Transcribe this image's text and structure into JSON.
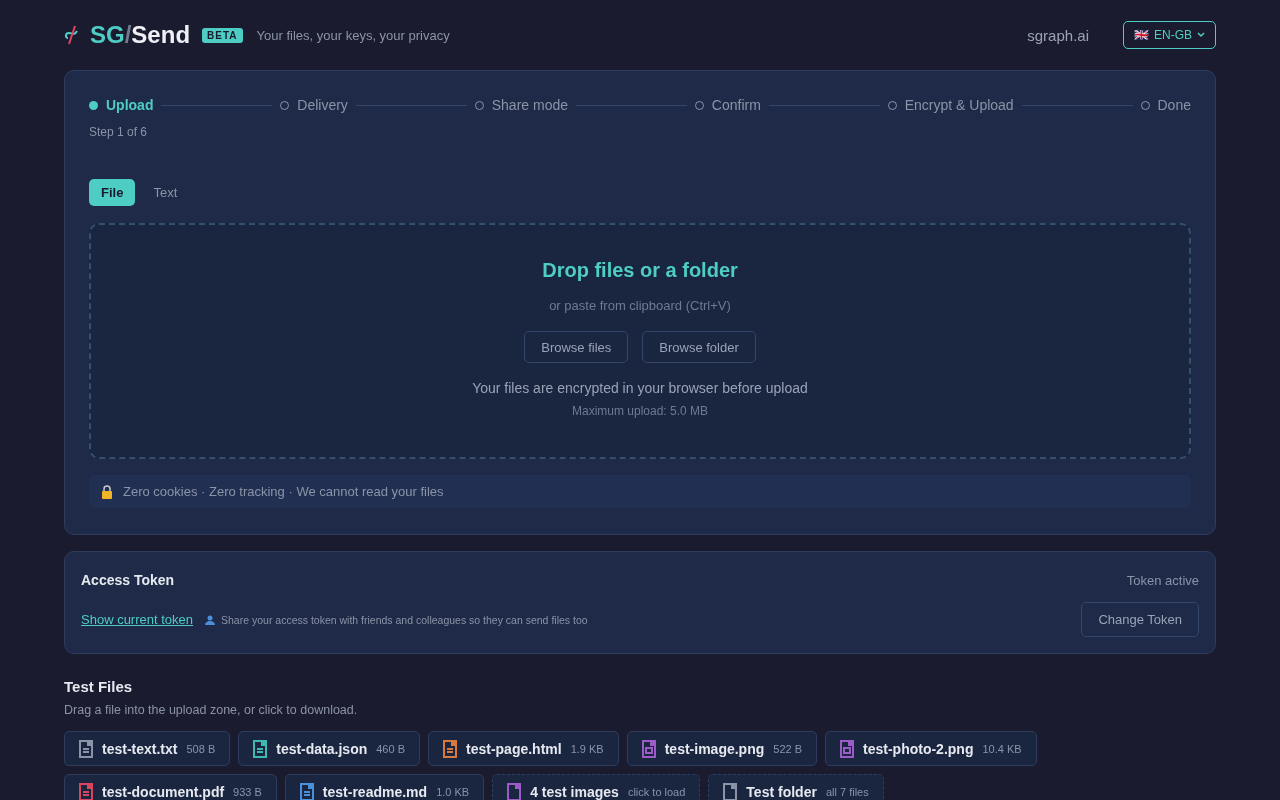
{
  "header": {
    "logo_left": "SG",
    "logo_sep": "/",
    "logo_right": "Send",
    "badge": "BETA",
    "tagline": "Your files, your keys, your privacy",
    "site_link": "sgraph.ai",
    "language": {
      "flag": "🇬🇧",
      "label": "EN-GB"
    }
  },
  "steps": [
    {
      "label": "Upload",
      "selected": true
    },
    {
      "label": "Delivery",
      "selected": false
    },
    {
      "label": "Share mode",
      "selected": false
    },
    {
      "label": "Confirm",
      "selected": false
    },
    {
      "label": "Encrypt & Upload",
      "selected": false
    },
    {
      "label": "Done",
      "selected": false
    }
  ],
  "step_counter": "Step 1 of 6",
  "tabs": [
    {
      "label": "File",
      "selected": true
    },
    {
      "label": "Text",
      "selected": false
    }
  ],
  "dropzone": {
    "title": "Drop files or a folder",
    "subtitle": "or paste from clipboard (Ctrl+V)",
    "buttons": [
      "Browse files",
      "Browse folder"
    ],
    "note": "Your files are encrypted in your browser before upload",
    "limit": "Maximum upload: 5.0 MB"
  },
  "privacy_note": "Zero cookies · Zero tracking · We cannot read your files",
  "access_token": {
    "title": "Access Token",
    "status": "Token active",
    "link": "Show current token",
    "hint": "Share your access token with friends and colleagues so they can send files too",
    "button": "Change Token"
  },
  "test_files": {
    "title": "Test Files",
    "subtitle": "Drag a file into the upload zone, or click to download.",
    "items": [
      {
        "kind": "file",
        "name": "test-text.txt",
        "size": "508 B",
        "color": "#8b93a7"
      },
      {
        "kind": "file",
        "name": "test-data.json",
        "size": "460 B",
        "color": "#3fb8b0"
      },
      {
        "kind": "file",
        "name": "test-page.html",
        "size": "1.9 KB",
        "color": "#d97a3c"
      },
      {
        "kind": "image",
        "name": "test-image.png",
        "size": "522 B",
        "color": "#9b5cc9"
      },
      {
        "kind": "image",
        "name": "test-photo-2.png",
        "size": "10.4 KB",
        "color": "#9b5cc9"
      },
      {
        "kind": "file",
        "name": "test-document.pdf",
        "size": "933 B",
        "color": "#d9455f"
      },
      {
        "kind": "file",
        "name": "test-readme.md",
        "size": "1.0 KB",
        "color": "#4a8fd9"
      },
      {
        "kind": "group",
        "name": "4 test images",
        "size": "click to load",
        "color": "#9b5cc9"
      },
      {
        "kind": "group",
        "name": "Test folder",
        "size": "all 7 files",
        "color": "#8b93a7"
      }
    ]
  }
}
